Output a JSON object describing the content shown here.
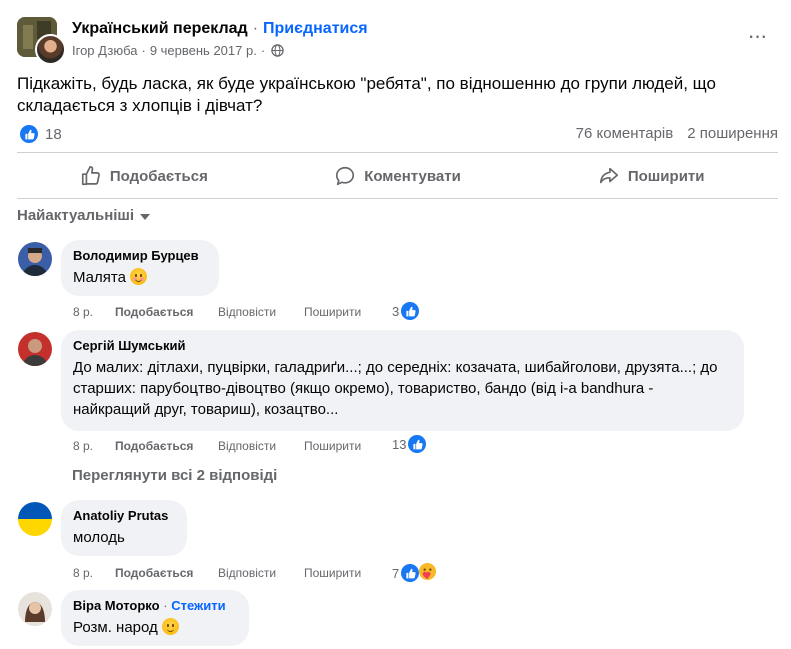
{
  "post": {
    "group_name": "Український переклад",
    "separator": "·",
    "join_label": "Приєднатися",
    "author": "Ігор Дзюба",
    "date": "9 червень 2017 р.",
    "privacy_icon": "globe-icon",
    "more_icon": "more-options-icon",
    "more_glyph": "···",
    "text": "Підкажіть, будь ласка, як буде українською \"ребята\", по відношенню до групи людей, що складається з хлопців і дівчат?",
    "reaction_count": "18",
    "comments_count": "76 коментарів",
    "shares_count": "2 поширення"
  },
  "actions": {
    "like": "Подобається",
    "comment": "Коментувати",
    "share": "Поширити"
  },
  "sort_label": "Найактуальніші",
  "comment_actions": {
    "like": "Подобається",
    "reply": "Відповісти",
    "share": "Поширити"
  },
  "comments": [
    {
      "name": "Володимир Бурцев",
      "text": "Малята",
      "emoji": "blush-emoji",
      "time": "8 р.",
      "reactions": "3"
    },
    {
      "name": "Сергій Шумський",
      "text": "До малих: дітлахи, пуцвірки, галадриґи...; до середніх: козачата, шибайголови, друзята...; до старших: парубоцтво-дівоцтво (якщо окремо), товариство, бандо (від і-а bandhura - найкращий друг, товариш), козацтво...",
      "time": "8 р.",
      "reactions": "13",
      "view_replies": "Переглянути всі 2 відповіді"
    },
    {
      "name": "Anatoliy Prutas",
      "text": "молодь",
      "time": "8 р.",
      "reactions": "7"
    },
    {
      "name": "Віра Моторко",
      "follow_label": "Стежити",
      "text": "Розм. народ",
      "emoji": "smile-emoji"
    }
  ],
  "colors": {
    "accent": "#0866ff",
    "like_blue": "#1877f2",
    "secondary_text": "#65676b",
    "bubble": "#f0f2f5"
  }
}
